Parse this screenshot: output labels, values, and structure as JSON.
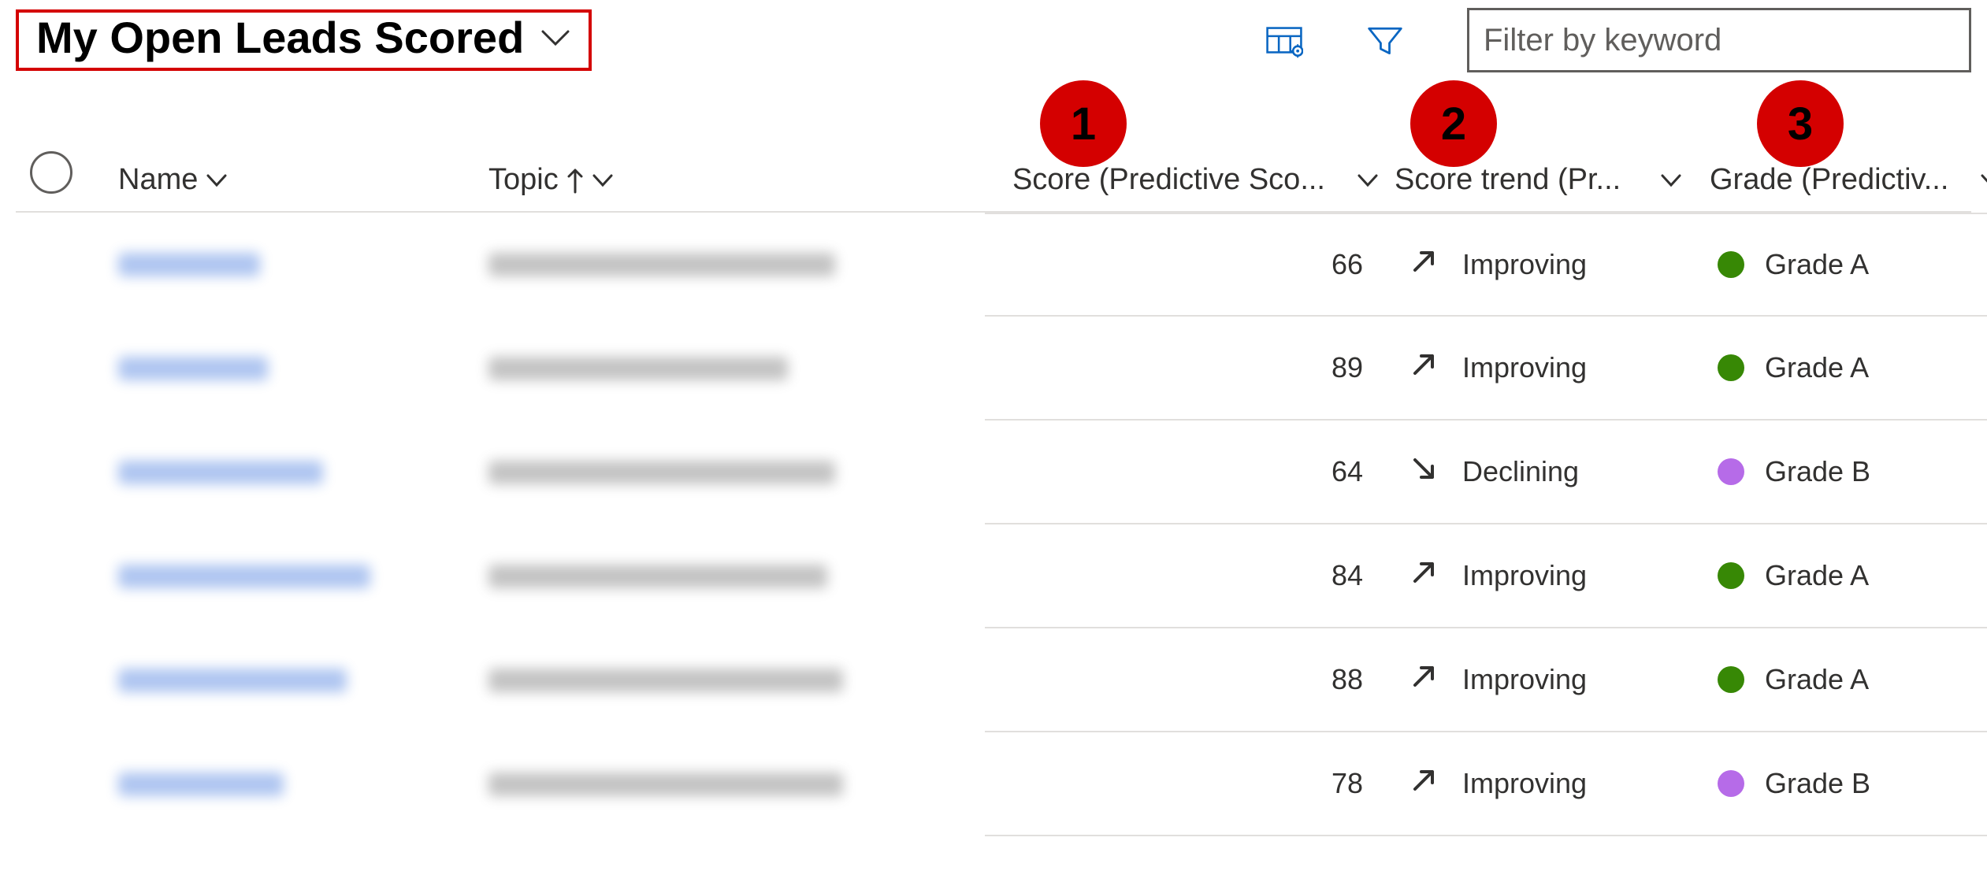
{
  "view": {
    "title": "My Open Leads Scored"
  },
  "toolbar": {
    "filter_placeholder": "Filter by keyword"
  },
  "annotations": [
    "1",
    "2",
    "3"
  ],
  "columns": {
    "name": "Name",
    "topic": "Topic",
    "score": "Score (Predictive Sco...",
    "trend": "Score trend (Pr...",
    "grade": "Grade (Predictiv..."
  },
  "colors": {
    "green": "#378805",
    "purple": "#b66be8"
  },
  "trend_labels": {
    "improving": "Improving",
    "declining": "Declining"
  },
  "grade_labels": {
    "a": "Grade A",
    "b": "Grade B"
  },
  "rows": [
    {
      "name_w": 180,
      "topic_w": 440,
      "score": "66",
      "trend_dir": "up",
      "trend_text": "Improving",
      "grade_color": "green",
      "grade_text": "Grade A"
    },
    {
      "name_w": 190,
      "topic_w": 380,
      "score": "89",
      "trend_dir": "up",
      "trend_text": "Improving",
      "grade_color": "green",
      "grade_text": "Grade A"
    },
    {
      "name_w": 260,
      "topic_w": 440,
      "score": "64",
      "trend_dir": "down",
      "trend_text": "Declining",
      "grade_color": "purple",
      "grade_text": "Grade B"
    },
    {
      "name_w": 320,
      "topic_w": 430,
      "score": "84",
      "trend_dir": "up",
      "trend_text": "Improving",
      "grade_color": "green",
      "grade_text": "Grade A"
    },
    {
      "name_w": 290,
      "topic_w": 450,
      "score": "88",
      "trend_dir": "up",
      "trend_text": "Improving",
      "grade_color": "green",
      "grade_text": "Grade A"
    },
    {
      "name_w": 210,
      "topic_w": 450,
      "score": "78",
      "trend_dir": "up",
      "trend_text": "Improving",
      "grade_color": "purple",
      "grade_text": "Grade B"
    }
  ]
}
